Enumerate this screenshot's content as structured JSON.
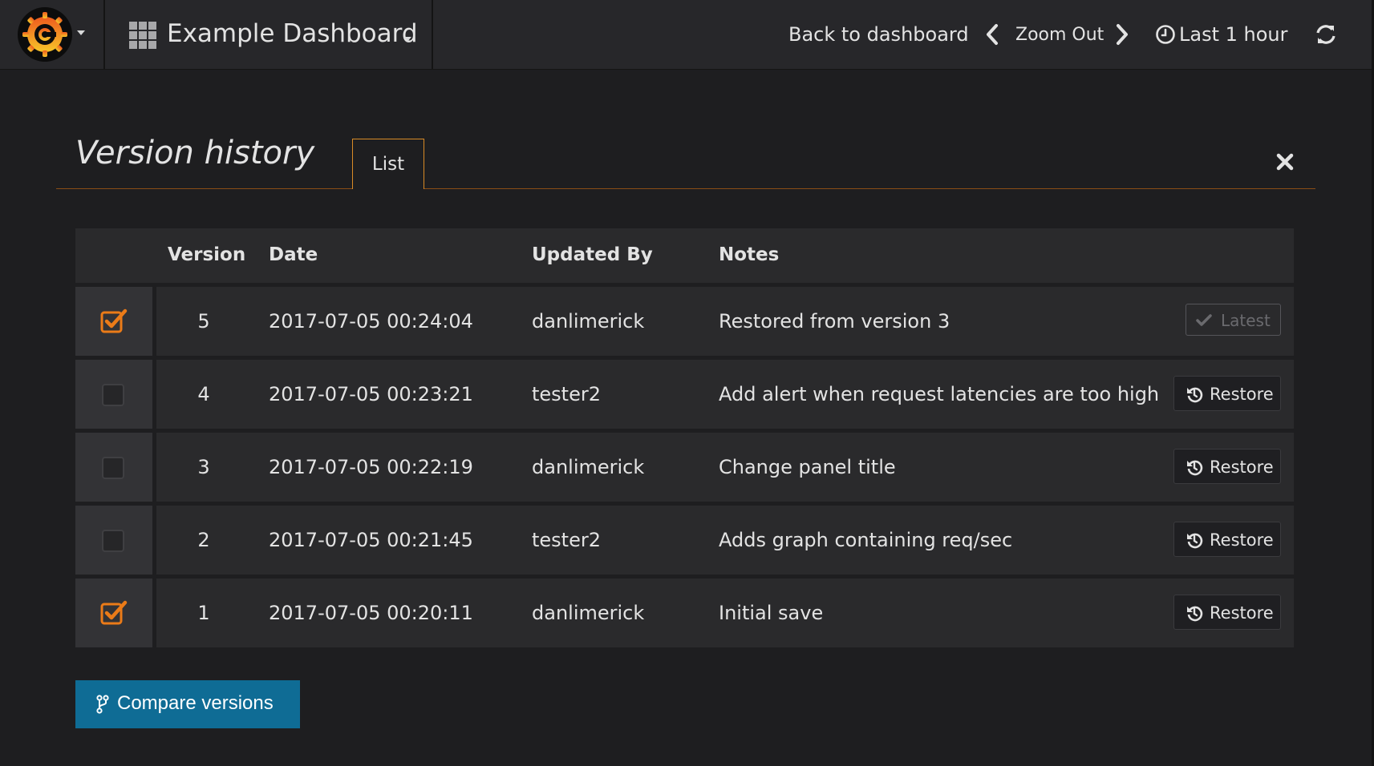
{
  "topbar": {
    "dashboard_title": "Example Dashboard",
    "back_to_dashboard": "Back to dashboard",
    "zoom_out": "Zoom Out",
    "time_range": "Last 1 hour"
  },
  "panel": {
    "title": "Version history",
    "tabs": [
      {
        "label": "List",
        "active": true
      }
    ]
  },
  "table": {
    "headers": {
      "version": "Version",
      "date": "Date",
      "updated_by": "Updated By",
      "notes": "Notes"
    },
    "rows": [
      {
        "version": "5",
        "date": "2017-07-05 00:24:04",
        "updated_by": "danlimerick",
        "notes": "Restored from version 3",
        "checked": true,
        "action": "Latest"
      },
      {
        "version": "4",
        "date": "2017-07-05 00:23:21",
        "updated_by": "tester2",
        "notes": "Add alert when request latencies are too high",
        "checked": false,
        "action": "Restore"
      },
      {
        "version": "3",
        "date": "2017-07-05 00:22:19",
        "updated_by": "danlimerick",
        "notes": "Change panel title",
        "checked": false,
        "action": "Restore"
      },
      {
        "version": "2",
        "date": "2017-07-05 00:21:45",
        "updated_by": "tester2",
        "notes": "Adds graph containing req/sec",
        "checked": false,
        "action": "Restore"
      },
      {
        "version": "1",
        "date": "2017-07-05 00:20:11",
        "updated_by": "danlimerick",
        "notes": "Initial save",
        "checked": true,
        "action": "Restore"
      }
    ]
  },
  "compare_button": "Compare versions",
  "colors": {
    "accent_orange": "#eb7b18",
    "primary_blue": "#0f6c95",
    "background": "#1e1e20"
  },
  "icons": {
    "logo": "grafana-logo",
    "dashboard": "grid-icon",
    "prev": "chevron-left-icon",
    "next": "chevron-right-icon",
    "time": "clock-icon",
    "refresh": "refresh-icon",
    "close": "close-icon",
    "restore": "history-icon",
    "latest": "check-icon",
    "compare": "code-fork-icon"
  }
}
